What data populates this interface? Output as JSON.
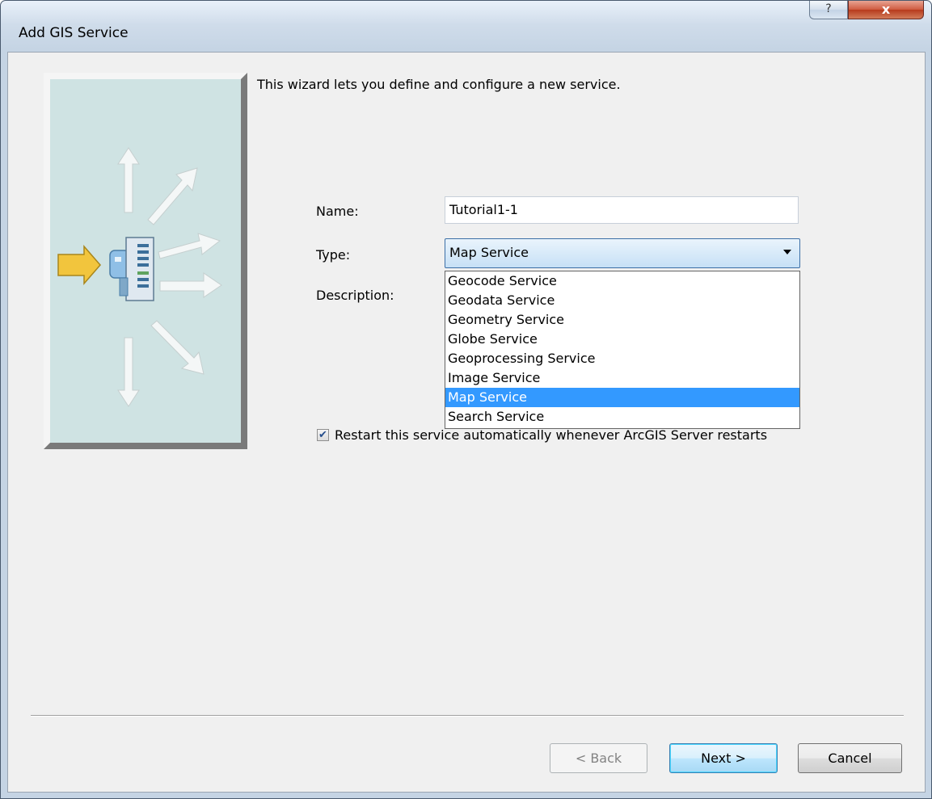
{
  "window": {
    "title": "Add GIS Service",
    "help_button": "?",
    "close_button": "x"
  },
  "wizard": {
    "intro": "This wizard lets you define and configure a new service."
  },
  "form": {
    "name_label": "Name:",
    "name_value": "Tutorial1-1",
    "type_label": "Type:",
    "type_value": "Map Service",
    "description_label": "Description:",
    "type_options": [
      {
        "label": "Geocode Service",
        "selected": false
      },
      {
        "label": "Geodata Service",
        "selected": false
      },
      {
        "label": "Geometry Service",
        "selected": false
      },
      {
        "label": "Globe Service",
        "selected": false
      },
      {
        "label": "Geoprocessing Service",
        "selected": false
      },
      {
        "label": "Image Service",
        "selected": false
      },
      {
        "label": "Map Service",
        "selected": true
      },
      {
        "label": "Search Service",
        "selected": false
      }
    ],
    "restart_checked": true,
    "restart_label": "Restart this service automatically whenever ArcGIS Server restarts"
  },
  "buttons": {
    "back": "< Back",
    "next": "Next >",
    "cancel": "Cancel"
  },
  "colors": {
    "selection": "#3399ff",
    "banner": "#cfe3e3",
    "arrow_accent": "#f2c53d"
  }
}
